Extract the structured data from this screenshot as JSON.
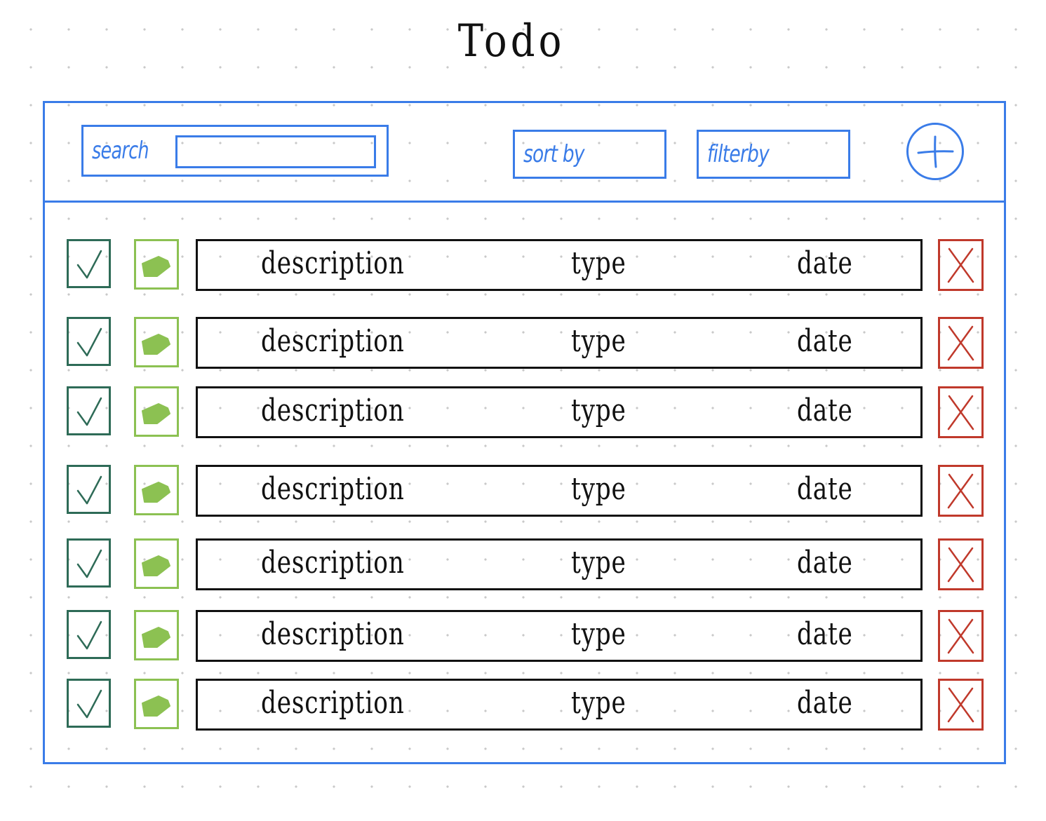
{
  "title": "Todo",
  "toolbar": {
    "search_label": "search",
    "search_value": "",
    "sort_label": "sort by",
    "filter_label": "filterby",
    "add_icon": "plus-icon"
  },
  "todos": [
    {
      "description": "description",
      "type": "type",
      "date": "date"
    },
    {
      "description": "description",
      "type": "type",
      "date": "date"
    },
    {
      "description": "description",
      "type": "type",
      "date": "date"
    },
    {
      "description": "description",
      "type": "type",
      "date": "date"
    },
    {
      "description": "description",
      "type": "type",
      "date": "date"
    },
    {
      "description": "description",
      "type": "type",
      "date": "date"
    },
    {
      "description": "description",
      "type": "type",
      "date": "date"
    }
  ],
  "row_icons": {
    "complete": "checkmark-icon",
    "edit": "pencil-icon",
    "delete": "x-icon"
  },
  "colors": {
    "frame": "#3a7ce8",
    "complete": "#2e6b57",
    "edit": "#8cc152",
    "delete": "#c0392b",
    "text": "#111111"
  }
}
